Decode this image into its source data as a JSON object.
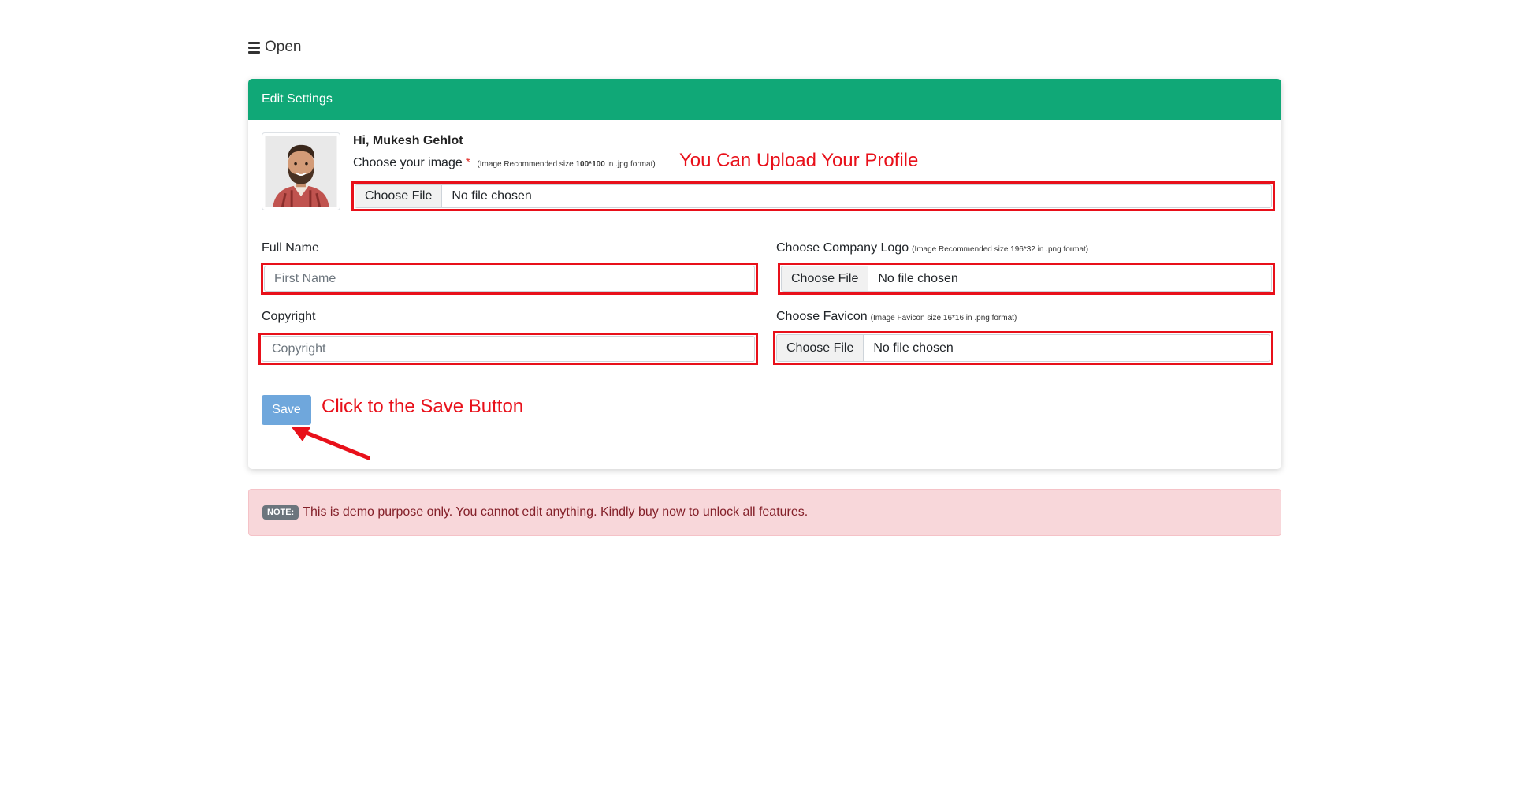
{
  "nav": {
    "menu_icon": "bars-icon",
    "open_label": "Open"
  },
  "card": {
    "title": "Edit Settings",
    "greeting_prefix": "Hi, ",
    "user_name": "Mukesh Gehlot",
    "avatar_icon": "user-avatar-image",
    "choose_image_label": "Choose your image",
    "required_mark": "*",
    "image_hint_pre": "(Image Recommended size ",
    "image_hint_size": "100*100",
    "image_hint_post": " in .jpg format)",
    "profile_annotation": "You Can Upload Your Profile",
    "profile_file": {
      "button": "Choose File",
      "status": "No file chosen"
    },
    "full_name": {
      "label": "Full Name",
      "placeholder": "First Name"
    },
    "copyright": {
      "label": "Copyright",
      "placeholder": "Copyright"
    },
    "company_logo": {
      "label": "Choose Company Logo",
      "hint": "(Image Recommended size 196*32 in .png format)",
      "button": "Choose File",
      "status": "No file chosen"
    },
    "favicon": {
      "label": "Choose Favicon",
      "hint": "(Image Favicon size 16*16 in .png format)",
      "button": "Choose File",
      "status": "No file chosen"
    },
    "save_label": "Save",
    "save_annotation": "Click to the Save Button"
  },
  "note": {
    "badge": "NOTE:",
    "text": "This is demo purpose only. You cannot edit anything. Kindly buy now to unlock all features."
  },
  "colors": {
    "header_green": "#10a877",
    "annotation_red": "#e8101a",
    "save_blue": "#6fa7dc",
    "note_bg": "#f8d7da"
  }
}
